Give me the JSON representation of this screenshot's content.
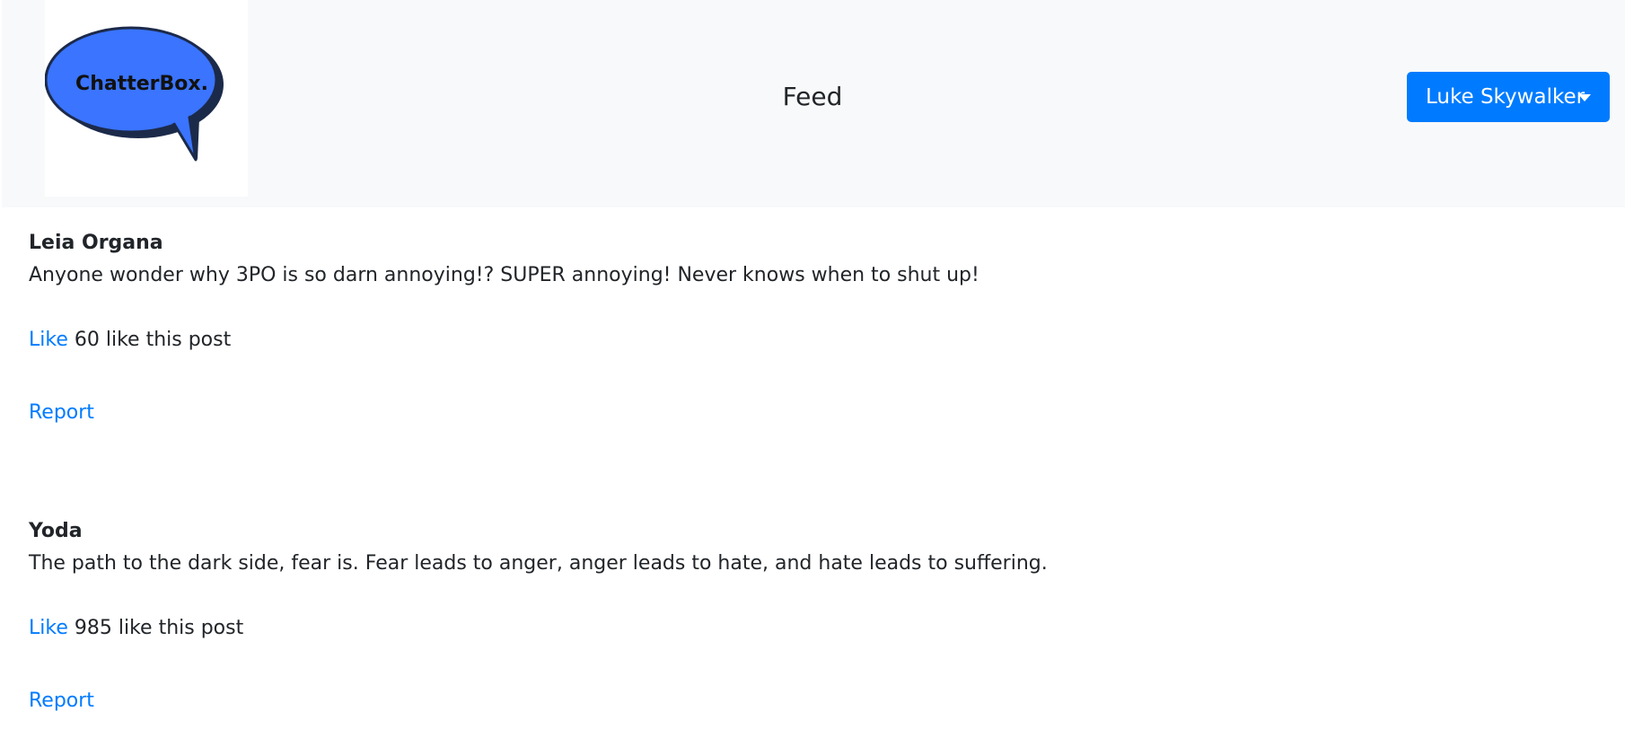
{
  "brand": {
    "logo_text": "ChatterBox.",
    "logo_fill": "#3a74ff",
    "logo_shadow": "#1c2a4a"
  },
  "header": {
    "title": "Feed",
    "user_menu_label": "Luke Skywalker",
    "user_menu_icon": "caret-down-icon"
  },
  "colors": {
    "primary": "#007bff",
    "navbar_bg": "#f8f9fa",
    "text": "#212529"
  },
  "posts": [
    {
      "author": "Leia Organa",
      "body": "Anyone wonder why 3PO is so darn annoying!? SUPER annoying! Never knows when to shut up!",
      "like_label": "Like",
      "like_count_text": "60 like this post",
      "report_label": "Report"
    },
    {
      "author": "Yoda",
      "body": "The path to the dark side, fear is. Fear leads to anger, anger leads to hate, and hate leads to suffering.",
      "like_label": "Like",
      "like_count_text": "985 like this post",
      "report_label": "Report"
    }
  ]
}
